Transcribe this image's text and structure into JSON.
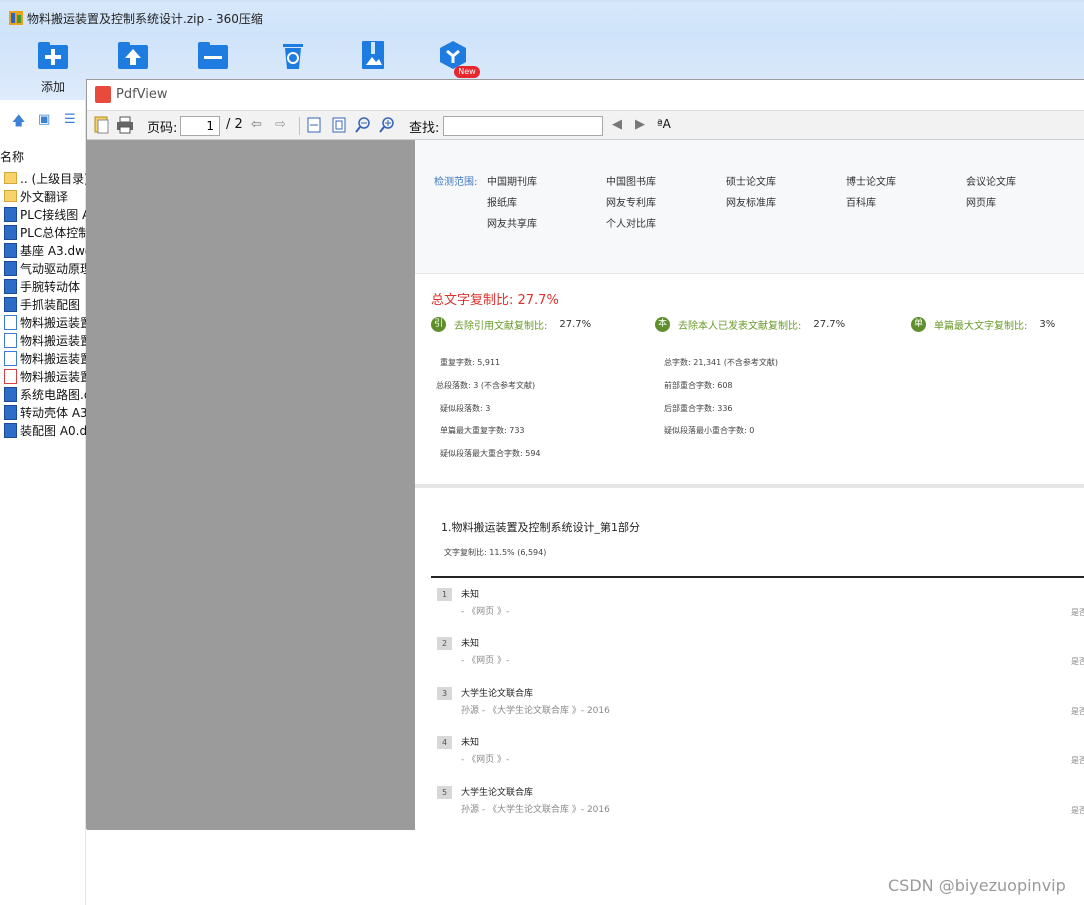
{
  "window": {
    "title": "物料搬运装置及控制系统设计.zip - 360压缩"
  },
  "toolbar": {
    "add_label": "添加",
    "new_badge": "New",
    "icons": [
      "add-icon",
      "extract-icon",
      "folder-icon",
      "delete-icon",
      "compress-icon",
      "tool-icon"
    ]
  },
  "sidebar": {
    "column_header": "名称",
    "files": [
      {
        "name": ".. (上级目录)",
        "type": "folder"
      },
      {
        "name": "外文翻译",
        "type": "folder"
      },
      {
        "name": "PLC接线图 A",
        "type": "dwg"
      },
      {
        "name": "PLC总体控制",
        "type": "dwg"
      },
      {
        "name": "基座 A3.dwg",
        "type": "dwg"
      },
      {
        "name": "气动驱动原理",
        "type": "dwg"
      },
      {
        "name": "手腕转动体",
        "type": "dwg"
      },
      {
        "name": "手抓装配图",
        "type": "dwg"
      },
      {
        "name": "物料搬运装置",
        "type": "doc"
      },
      {
        "name": "物料搬运装置",
        "type": "doc"
      },
      {
        "name": "物料搬运装置",
        "type": "doc"
      },
      {
        "name": "物料搬运装置",
        "type": "pdf"
      },
      {
        "name": "系统电路图.d",
        "type": "dwg"
      },
      {
        "name": "转动壳体 A3",
        "type": "dwg"
      },
      {
        "name": "装配图 A0.d",
        "type": "dwg"
      }
    ]
  },
  "pdf": {
    "title": "PdfView",
    "page_label": "页码:",
    "page_current": "1",
    "page_total": "/ 2",
    "search_label": "查找:",
    "search_value": ""
  },
  "report": {
    "scope_label": "检测范围:",
    "scope_row1": [
      "中国期刊库",
      "中国图书库",
      "硕士论文库",
      "博士论文库",
      "会议论文库"
    ],
    "scope_row2": [
      "报纸库",
      "网友专利库",
      "网友标准库",
      "百科库",
      "网页库"
    ],
    "scope_row3": [
      "网友共享库",
      "个人对比库"
    ],
    "total_label": "总文字复制比: 27.7%",
    "metric1_label": "去除引用文献复制比:",
    "metric1_value": "27.7%",
    "metric2_label": "去除本人已发表文献复制比:",
    "metric2_value": "27.7%",
    "metric3_label": "单篇最大文字复制比:",
    "metric3_value": "3%",
    "stats_left": [
      "重复字数: 5,911",
      "总段落数: 3 (不含参考文献)",
      "疑似段落数: 3",
      "单篇最大重复字数: 733",
      "疑似段落最大重合字数: 594"
    ],
    "stats_right": [
      "总字数: 21,341 (不含参考文献)",
      "前部重合字数: 608",
      "后部重合字数: 336",
      "疑似段落最小重合字数: 0"
    ],
    "section_title": "1.物料搬运装置及控制系统设计_第1部分",
    "section_ratio": "文字复制比: 11.5% (6,594)",
    "sources": [
      {
        "num": "1",
        "name": "未知",
        "meta": "- 《网页 》-",
        "flag": "是否引证:否"
      },
      {
        "num": "2",
        "name": "未知",
        "meta": "- 《网页 》-",
        "flag": "是否引证:否"
      },
      {
        "num": "3",
        "name": "大学生论文联合库",
        "meta": "孙源 - 《大学生论文联合库 》- 2016",
        "flag": "是否引证:否"
      },
      {
        "num": "4",
        "name": "未知",
        "meta": "- 《网页 》-",
        "flag": "是否引证:否"
      },
      {
        "num": "5",
        "name": "大学生论文联合库",
        "meta": "孙源 - 《大学生论文联合库 》- 2016",
        "flag": "是否引证:否"
      }
    ]
  },
  "watermark": "CSDN @biyezuopinvip"
}
